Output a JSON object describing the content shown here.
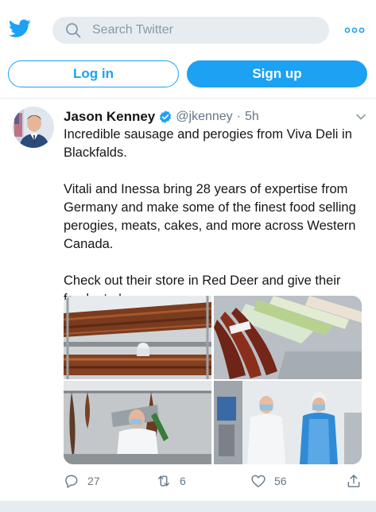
{
  "search": {
    "placeholder": "Search Twitter"
  },
  "auth": {
    "login_label": "Log in",
    "signup_label": "Sign up"
  },
  "tweet": {
    "author_name": "Jason Kenney",
    "author_handle": "@jkenney",
    "separator": "·",
    "time": "5h",
    "verified": true,
    "paragraphs": [
      "Incredible sausage and perogies from Viva Deli in Blackfalds.",
      "Vitali and Inessa bring 28 years of expertise from Germany and make some of the finest food selling perogies, meats, cakes, and more across Western Canada.",
      "Check out their store in Red Deer and give their food a try!"
    ],
    "photo_count": 4,
    "stats": {
      "replies": "27",
      "retweets": "6",
      "likes": "56"
    }
  },
  "icons": {
    "logo": "twitter-bird-icon",
    "search": "search-icon",
    "more": "more-dots-icon",
    "verified": "verified-badge-icon",
    "caret": "chevron-down-icon",
    "reply": "reply-icon",
    "retweet": "retweet-icon",
    "like": "heart-icon",
    "share": "share-icon"
  },
  "colors": {
    "brand": "#1da1f2",
    "text": "#14171a",
    "muted": "#657786",
    "search_bg": "#e6ecf0"
  }
}
